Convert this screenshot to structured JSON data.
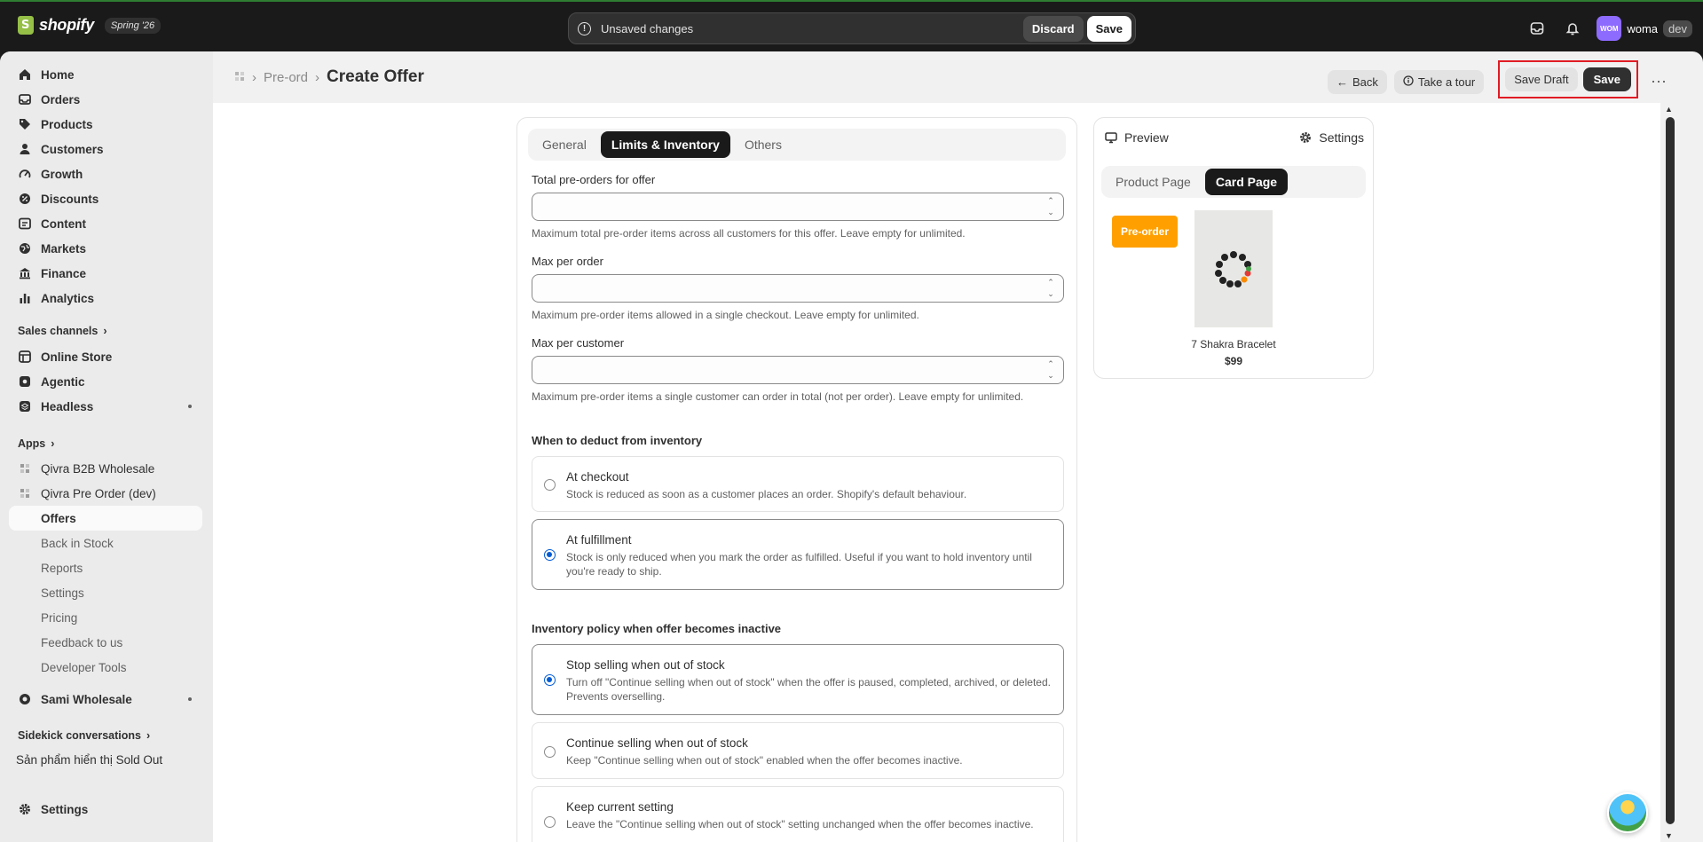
{
  "topbar": {
    "brand": "shopify",
    "edition": "Spring '26",
    "unsaved_message": "Unsaved changes",
    "discard_label": "Discard",
    "save_label": "Save",
    "avatar_initials": "WOM",
    "user_name": "woma",
    "env_badge": "dev"
  },
  "sidebar": {
    "main_items": [
      "Home",
      "Orders",
      "Products",
      "Customers",
      "Growth",
      "Discounts",
      "Content",
      "Markets",
      "Finance",
      "Analytics"
    ],
    "sales_channels_label": "Sales channels",
    "channels": [
      "Online Store",
      "Agentic",
      "Headless"
    ],
    "apps_label": "Apps",
    "apps": [
      "Qivra B2B Wholesale",
      "Qivra Pre Order (dev)"
    ],
    "app_subitems": [
      "Offers",
      "Back in Stock",
      "Reports",
      "Settings",
      "Pricing",
      "Feedback to us",
      "Developer Tools"
    ],
    "active_subitem": "Offers",
    "extra_app": "Sami Wholesale",
    "sidekick_label": "Sidekick conversations",
    "sidekick_item": "Sản phẩm hiển thị Sold Out",
    "settings_label": "Settings"
  },
  "header": {
    "breadcrumb_parent": "Pre-ord",
    "title": "Create Offer",
    "back_label": "Back",
    "tour_label": "Take a tour",
    "save_draft_label": "Save Draft",
    "save_label": "Save",
    "more_label": "⋯"
  },
  "form": {
    "tabs": [
      "General",
      "Limits & Inventory",
      "Others"
    ],
    "active_tab": "Limits & Inventory",
    "total_label": "Total pre-orders for offer",
    "total_value": "",
    "total_help": "Maximum total pre-order items across all customers for this offer. Leave empty for unlimited.",
    "per_order_label": "Max per order",
    "per_order_value": "",
    "per_order_help": "Maximum pre-order items allowed in a single checkout. Leave empty for unlimited.",
    "per_customer_label": "Max per customer",
    "per_customer_value": "",
    "per_customer_help": "Maximum pre-order items a single customer can order in total (not per order). Leave empty for unlimited.",
    "deduct_title": "When to deduct from inventory",
    "deduct_options": [
      {
        "title": "At checkout",
        "desc": "Stock is reduced as soon as a customer places an order. Shopify's default behaviour.",
        "selected": false
      },
      {
        "title": "At fulfillment",
        "desc": "Stock is only reduced when you mark the order as fulfilled. Useful if you want to hold inventory until you're ready to ship.",
        "selected": true
      }
    ],
    "policy_title": "Inventory policy when offer becomes inactive",
    "policy_options": [
      {
        "title": "Stop selling when out of stock",
        "desc": "Turn off \"Continue selling when out of stock\" when the offer is paused, completed, archived, or deleted. Prevents overselling.",
        "selected": true
      },
      {
        "title": "Continue selling when out of stock",
        "desc": "Keep \"Continue selling when out of stock\" enabled when the offer becomes inactive.",
        "selected": false
      },
      {
        "title": "Keep current setting",
        "desc": "Leave the \"Continue selling when out of stock\" setting unchanged when the offer becomes inactive.",
        "selected": false
      }
    ]
  },
  "preview": {
    "title": "Preview",
    "settings_label": "Settings",
    "tabs": [
      "Product Page",
      "Card Page"
    ],
    "active_tab": "Card Page",
    "badge_label": "Pre-order",
    "badge_color": "#ffa000",
    "product_name": "7 Shakra Bracelet",
    "product_price": "$99"
  }
}
